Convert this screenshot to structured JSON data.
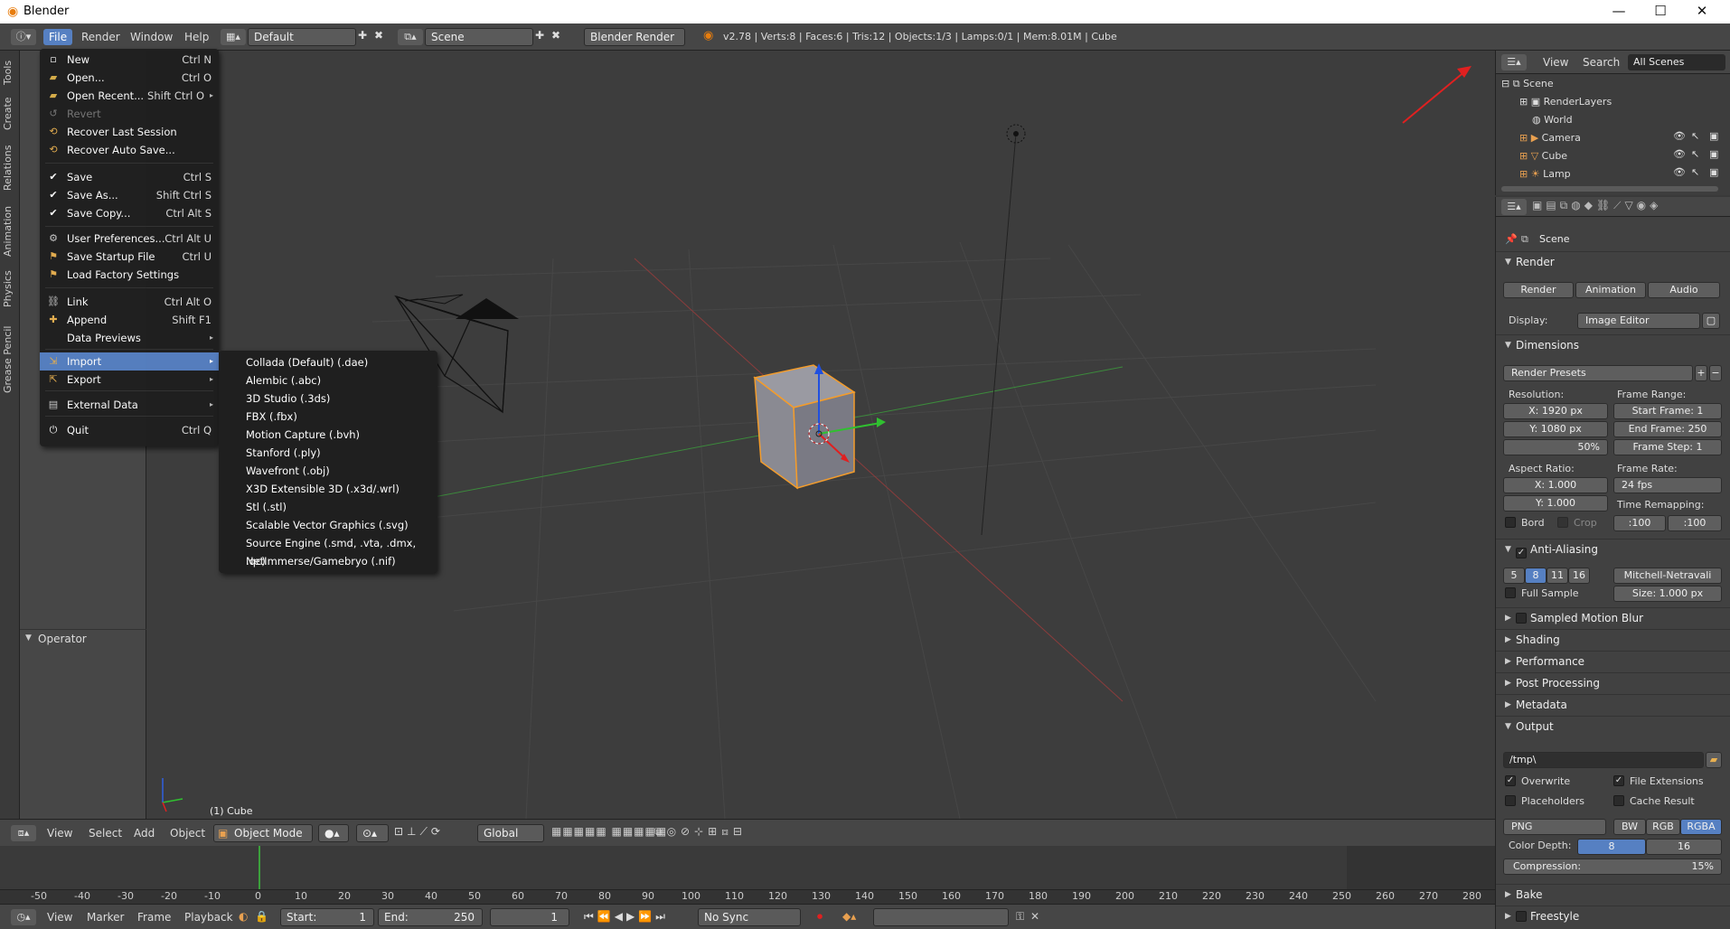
{
  "window": {
    "title": "Blender",
    "minimize": "—",
    "maximize": "☐",
    "close": "✕"
  },
  "topbar": {
    "menus": [
      "File",
      "Render",
      "Window",
      "Help"
    ],
    "layout": "Default",
    "scene": "Scene",
    "engine": "Blender Render",
    "stats": "v2.78 | Verts:8 | Faces:6 | Tris:12 | Objects:1/3 | Lamps:0/1 | Mem:8.01M | Cube"
  },
  "left_tabs": [
    "Tools",
    "Create",
    "Relations",
    "Animation",
    "Physics",
    "Grease Pencil"
  ],
  "file_menu": [
    {
      "label": "New",
      "shortcut": "Ctrl N",
      "icon": "new-file-icon"
    },
    {
      "label": "Open...",
      "shortcut": "Ctrl O",
      "icon": "open-folder-icon"
    },
    {
      "label": "Open Recent...",
      "shortcut": "Shift Ctrl O",
      "icon": "open-recent-icon",
      "arrow": true
    },
    {
      "label": "Revert",
      "shortcut": "",
      "icon": "revert-icon",
      "disabled": true
    },
    {
      "label": "Recover Last Session",
      "shortcut": "",
      "icon": "recover-icon"
    },
    {
      "label": "Recover Auto Save...",
      "shortcut": "",
      "icon": "recover-auto-icon"
    },
    {
      "label": "Save",
      "shortcut": "Ctrl S",
      "icon": "save-check-icon"
    },
    {
      "label": "Save As...",
      "shortcut": "Shift Ctrl S",
      "icon": "save-as-check-icon"
    },
    {
      "label": "Save Copy...",
      "shortcut": "Ctrl Alt S",
      "icon": "save-copy-check-icon"
    },
    {
      "label": "User Preferences...",
      "shortcut": "Ctrl Alt U",
      "icon": "preferences-icon"
    },
    {
      "label": "Save Startup File",
      "shortcut": "Ctrl U",
      "icon": "save-startup-icon"
    },
    {
      "label": "Load Factory Settings",
      "shortcut": "",
      "icon": "factory-settings-icon"
    },
    {
      "label": "Link",
      "shortcut": "Ctrl Alt O",
      "icon": "link-icon"
    },
    {
      "label": "Append",
      "shortcut": "Shift F1",
      "icon": "append-icon"
    },
    {
      "label": "Data Previews",
      "shortcut": "",
      "icon": "",
      "arrow": true
    },
    {
      "label": "Import",
      "shortcut": "",
      "icon": "import-icon",
      "arrow": true,
      "selected": true
    },
    {
      "label": "Export",
      "shortcut": "",
      "icon": "export-icon",
      "arrow": true
    },
    {
      "label": "External Data",
      "shortcut": "",
      "icon": "external-data-icon",
      "arrow": true
    },
    {
      "label": "Quit",
      "shortcut": "Ctrl Q",
      "icon": "quit-icon"
    }
  ],
  "import_submenu": [
    "Collada (Default) (.dae)",
    "Alembic (.abc)",
    "3D Studio (.3ds)",
    "FBX (.fbx)",
    "Motion Capture (.bvh)",
    "Stanford (.ply)",
    "Wavefront (.obj)",
    "X3D Extensible 3D (.x3d/.wrl)",
    "Stl (.stl)",
    "Scalable Vector Graphics (.svg)",
    "Source Engine (.smd, .vta, .dmx, .qc)",
    "NetImmerse/Gamebryo (.nif)"
  ],
  "toolshelf": {
    "operator": "Operator"
  },
  "viewport": {
    "object_label": "(1) Cube"
  },
  "outliner": {
    "view": "View",
    "search": "Search",
    "filter": "All Scenes",
    "items": [
      "Scene",
      "RenderLayers",
      "World",
      "Camera",
      "Cube",
      "Lamp"
    ]
  },
  "properties": {
    "context": "Scene",
    "render": {
      "title": "Render",
      "render_btn": "Render",
      "animation_btn": "Animation",
      "audio_btn": "Audio",
      "display_label": "Display:",
      "display_value": "Image Editor"
    },
    "dimensions": {
      "title": "Dimensions",
      "presets": "Render Presets",
      "resolution_label": "Resolution:",
      "res_x": "X:   1920 px",
      "res_y": "Y:   1080 px",
      "res_pct": "50%",
      "frame_range_label": "Frame Range:",
      "start_frame": "Start Frame:   1",
      "end_frame": "End Frame: 250",
      "frame_step": "Frame Step:   1",
      "aspect_label": "Aspect Ratio:",
      "aspect_x": "X:        1.000",
      "aspect_y": "Y:        1.000",
      "frame_rate_label": "Frame Rate:",
      "fps": "24 fps",
      "time_remap_label": "Time Remapping:",
      "remap_old": ":100",
      "remap_new": ":100",
      "bord": "Bord",
      "crop": "Crop"
    },
    "anti_aliasing": {
      "title": "Anti-Aliasing",
      "samples": [
        "5",
        "8",
        "11",
        "16"
      ],
      "filter": "Mitchell-Netravali",
      "full_sample": "Full Sample",
      "size": "Size:  1.000 px"
    },
    "collapsed_panels": [
      "Sampled Motion Blur",
      "Shading",
      "Performance",
      "Post Processing",
      "Metadata"
    ],
    "output": {
      "title": "Output",
      "path": "/tmp\\",
      "overwrite": "Overwrite",
      "file_extensions": "File Extensions",
      "placeholders": "Placeholders",
      "cache_result": "Cache Result",
      "format": "PNG",
      "bw": "BW",
      "rgb": "RGB",
      "rgba": "RGBA",
      "color_depth_label": "Color Depth:",
      "depth_8": "8",
      "depth_16": "16",
      "compression": "Compression:",
      "compression_value": "15%"
    },
    "bake": "Bake",
    "freestyle": "Freestyle"
  },
  "viewport_header": {
    "menus": [
      "View",
      "Select",
      "Add",
      "Object"
    ],
    "mode": "Object Mode",
    "orientation": "Global"
  },
  "timeline": {
    "ticks": [
      "-50",
      "-40",
      "-30",
      "-20",
      "-10",
      "0",
      "10",
      "20",
      "30",
      "40",
      "50",
      "60",
      "70",
      "80",
      "90",
      "100",
      "110",
      "120",
      "130",
      "140",
      "150",
      "160",
      "170",
      "180",
      "190",
      "200",
      "210",
      "220",
      "230",
      "240",
      "250",
      "260",
      "270",
      "280"
    ],
    "menus": [
      "View",
      "Marker",
      "Frame",
      "Playback"
    ],
    "start": "Start:",
    "start_value": "1",
    "end": "End:",
    "end_value": "250",
    "current": "1",
    "sync": "No Sync"
  },
  "colors": {
    "accent": "#5680c2",
    "selection": "#f39c2c",
    "annotation_arrow": "#e02020"
  }
}
